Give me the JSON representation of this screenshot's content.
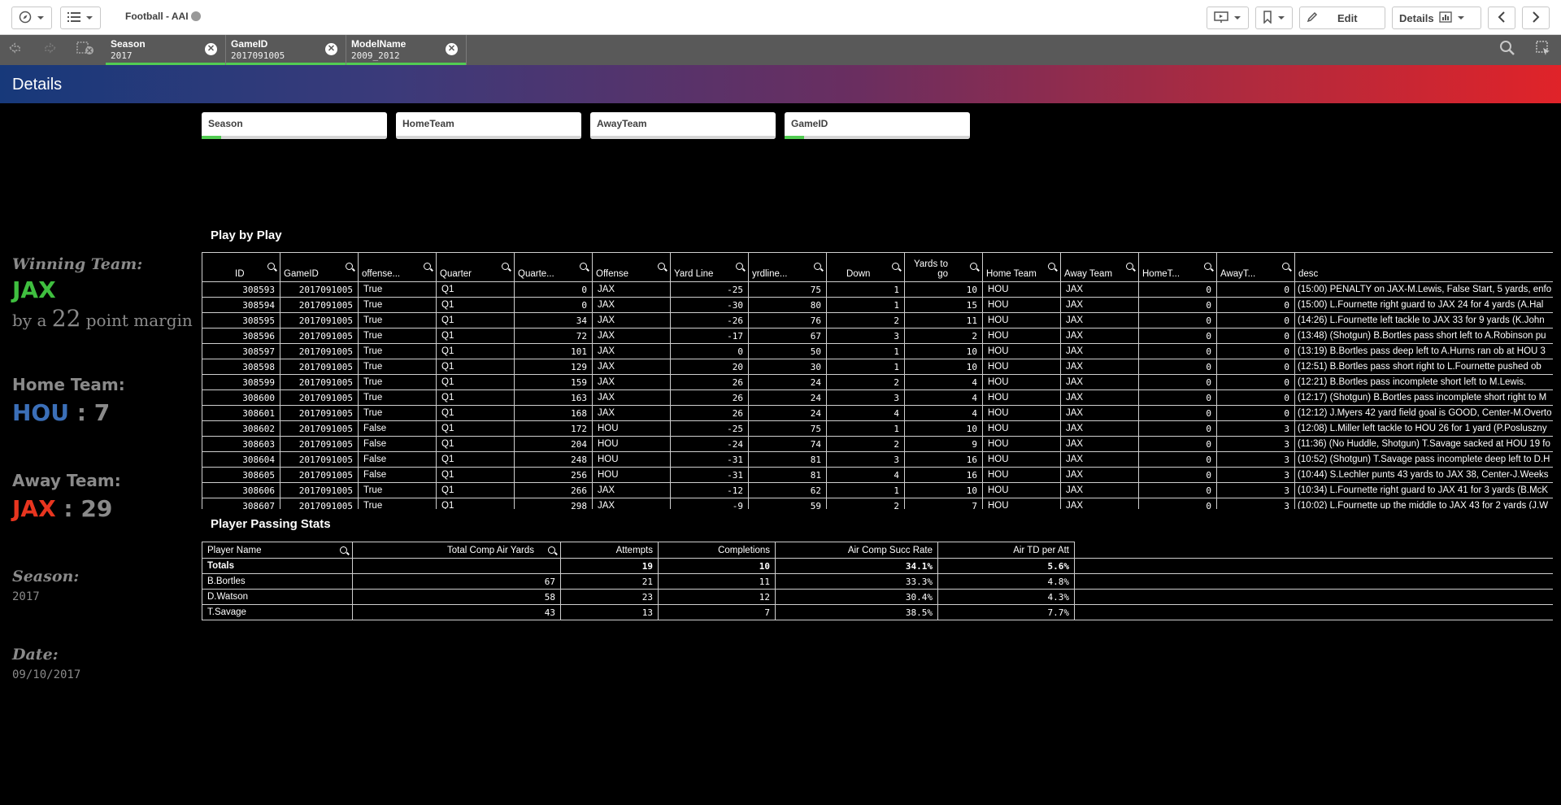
{
  "toolbar": {
    "app_title": "Football - AAI",
    "edit_label": "Edit",
    "details_label": "Details"
  },
  "selections": [
    {
      "field": "Season",
      "value": "2017"
    },
    {
      "field": "GameID",
      "value": "2017091005"
    },
    {
      "field": "ModelName",
      "value": "2009_2012"
    }
  ],
  "sheet_title": "Details",
  "filters": [
    "Season",
    "HomeTeam",
    "AwayTeam",
    "GameID"
  ],
  "kpi": {
    "winning_label": "Winning Team:",
    "winning_team": "JAX",
    "margin_prefix": "by a",
    "margin_value": "22",
    "margin_suffix": "point margin",
    "home_label": "Home Team:",
    "home_team": "HOU",
    "home_score": "7",
    "away_label": "Away Team:",
    "away_team": "JAX",
    "away_score": "29",
    "season_label": "Season:",
    "season_value": "2017",
    "date_label": "Date:",
    "date_value": "09/10/2017",
    "colors": {
      "winning": "#3fbf3f",
      "home": "#3b6fb8",
      "away": "#e8351f",
      "score": "#8a8a8a"
    }
  },
  "pbp": {
    "title": "Play by Play",
    "columns": [
      "ID",
      "GameID",
      "offense...",
      "Quarter",
      "Quarte...",
      "Offense",
      "Yard Line",
      "yrdline...",
      "Down",
      "Yards to go",
      "Home Team",
      "Away Team",
      "HomeT...",
      "AwayT...",
      "desc"
    ],
    "rows": [
      [
        "308593",
        "2017091005",
        "True",
        "Q1",
        "0",
        "JAX",
        "-25",
        "75",
        "1",
        "10",
        "HOU",
        "JAX",
        "0",
        "0",
        "(15:00) PENALTY on JAX-M.Lewis, False Start, 5 yards, enfo"
      ],
      [
        "308594",
        "2017091005",
        "True",
        "Q1",
        "0",
        "JAX",
        "-30",
        "80",
        "1",
        "15",
        "HOU",
        "JAX",
        "0",
        "0",
        "(15:00) L.Fournette right guard to JAX 24 for 4 yards (A.Hal"
      ],
      [
        "308595",
        "2017091005",
        "True",
        "Q1",
        "34",
        "JAX",
        "-26",
        "76",
        "2",
        "11",
        "HOU",
        "JAX",
        "0",
        "0",
        "(14:26) L.Fournette left tackle to JAX 33 for 9 yards (K.John"
      ],
      [
        "308596",
        "2017091005",
        "True",
        "Q1",
        "72",
        "JAX",
        "-17",
        "67",
        "3",
        "2",
        "HOU",
        "JAX",
        "0",
        "0",
        "(13:48) (Shotgun) B.Bortles pass short left to A.Robinson pu"
      ],
      [
        "308597",
        "2017091005",
        "True",
        "Q1",
        "101",
        "JAX",
        "0",
        "50",
        "1",
        "10",
        "HOU",
        "JAX",
        "0",
        "0",
        "(13:19) B.Bortles pass deep left to A.Hurns ran ob at HOU 3"
      ],
      [
        "308598",
        "2017091005",
        "True",
        "Q1",
        "129",
        "JAX",
        "20",
        "30",
        "1",
        "10",
        "HOU",
        "JAX",
        "0",
        "0",
        "(12:51) B.Bortles pass short right to L.Fournette pushed ob"
      ],
      [
        "308599",
        "2017091005",
        "True",
        "Q1",
        "159",
        "JAX",
        "26",
        "24",
        "2",
        "4",
        "HOU",
        "JAX",
        "0",
        "0",
        "(12:21) B.Bortles pass incomplete short left to M.Lewis."
      ],
      [
        "308600",
        "2017091005",
        "True",
        "Q1",
        "163",
        "JAX",
        "26",
        "24",
        "3",
        "4",
        "HOU",
        "JAX",
        "0",
        "0",
        "(12:17) (Shotgun) B.Bortles pass incomplete short right to M"
      ],
      [
        "308601",
        "2017091005",
        "True",
        "Q1",
        "168",
        "JAX",
        "26",
        "24",
        "4",
        "4",
        "HOU",
        "JAX",
        "0",
        "0",
        "(12:12) J.Myers 42 yard field goal is GOOD, Center-M.Overto"
      ],
      [
        "308602",
        "2017091005",
        "False",
        "Q1",
        "172",
        "HOU",
        "-25",
        "75",
        "1",
        "10",
        "HOU",
        "JAX",
        "0",
        "3",
        "(12:08) L.Miller left tackle to HOU 26 for 1 yard (P.Posluszny"
      ],
      [
        "308603",
        "2017091005",
        "False",
        "Q1",
        "204",
        "HOU",
        "-24",
        "74",
        "2",
        "9",
        "HOU",
        "JAX",
        "0",
        "3",
        "(11:36) (No Huddle, Shotgun) T.Savage sacked at HOU 19 fo"
      ],
      [
        "308604",
        "2017091005",
        "False",
        "Q1",
        "248",
        "HOU",
        "-31",
        "81",
        "3",
        "16",
        "HOU",
        "JAX",
        "0",
        "3",
        "(10:52) (Shotgun) T.Savage pass incomplete deep left to D.H"
      ],
      [
        "308605",
        "2017091005",
        "False",
        "Q1",
        "256",
        "HOU",
        "-31",
        "81",
        "4",
        "16",
        "HOU",
        "JAX",
        "0",
        "3",
        "(10:44) S.Lechler punts 43 yards to JAX 38, Center-J.Weeks"
      ],
      [
        "308606",
        "2017091005",
        "True",
        "Q1",
        "266",
        "JAX",
        "-12",
        "62",
        "1",
        "10",
        "HOU",
        "JAX",
        "0",
        "3",
        "(10:34) L.Fournette right guard to JAX 41 for 3 yards (B.McK"
      ],
      [
        "308607",
        "2017091005",
        "True",
        "Q1",
        "298",
        "JAX",
        "-9",
        "59",
        "2",
        "7",
        "HOU",
        "JAX",
        "0",
        "3",
        "(10:02) L.Fournette up the middle to JAX 43 for 2 yards (J.W"
      ]
    ]
  },
  "pps": {
    "title": "Player Passing Stats",
    "columns": [
      "Player Name",
      "Total Comp Air Yards",
      "Attempts",
      "Completions",
      "Air Comp Succ Rate",
      "Air TD per Att"
    ],
    "totals": [
      "Totals",
      "",
      "19",
      "10",
      "34.1%",
      "5.6%"
    ],
    "rows": [
      [
        "B.Bortles",
        "67",
        "21",
        "11",
        "33.3%",
        "4.8%"
      ],
      [
        "D.Watson",
        "58",
        "23",
        "12",
        "30.4%",
        "4.3%"
      ],
      [
        "T.Savage",
        "43",
        "13",
        "7",
        "38.5%",
        "7.7%"
      ]
    ]
  }
}
